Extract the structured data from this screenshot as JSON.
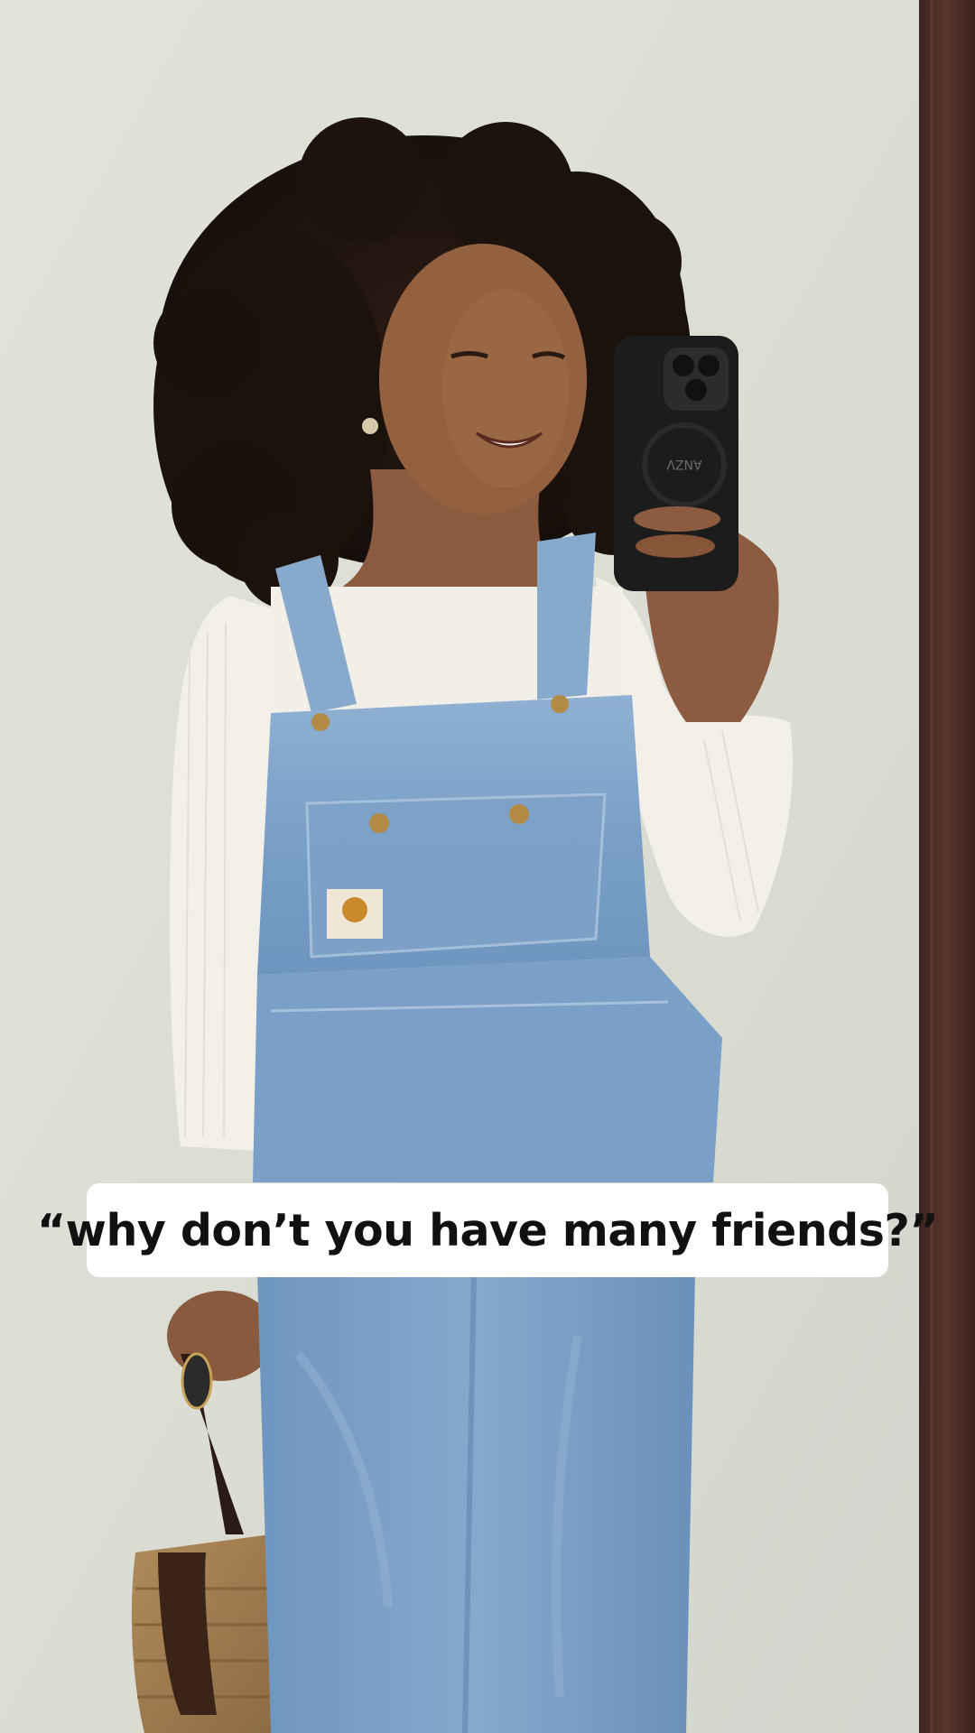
{
  "caption": {
    "text": "“why don’t you have many friends?”"
  },
  "photo": {
    "phone_case_logo": "ANZV",
    "colors": {
      "wall": "#dddfd6",
      "door_frame": "#4a2c25",
      "denim": "#7ea3c8",
      "top": "#f3f1ea",
      "hair": "#1e1410",
      "skin": "#8b5a3f",
      "phone": "#1c1c1c"
    }
  }
}
